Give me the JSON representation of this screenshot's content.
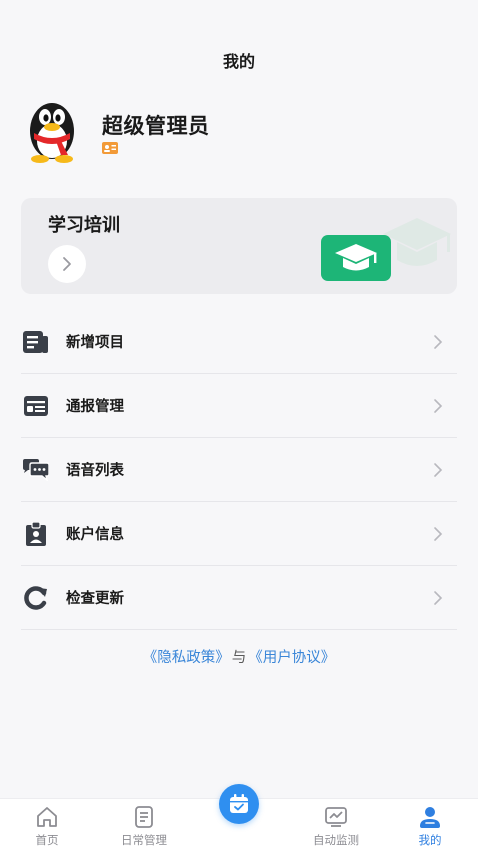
{
  "header": {
    "title": "我的"
  },
  "profile": {
    "username": "超级管理员"
  },
  "training_card": {
    "title": "学习培训"
  },
  "menu": {
    "items": [
      {
        "label": "新增项目",
        "icon": "document-icon"
      },
      {
        "label": "通报管理",
        "icon": "id-card-icon"
      },
      {
        "label": "语音列表",
        "icon": "chat-bubbles-icon"
      },
      {
        "label": "账户信息",
        "icon": "clipboard-user-icon"
      },
      {
        "label": "检查更新",
        "icon": "refresh-icon"
      }
    ]
  },
  "footer": {
    "privacy_link": "《隐私政策》",
    "separator": "与",
    "agreement_link": "《用户协议》"
  },
  "tabbar": {
    "tabs": [
      {
        "label": "首页",
        "icon": "home-icon"
      },
      {
        "label": "日常管理",
        "icon": "list-icon"
      },
      {
        "label": "",
        "icon": "calendar-check-icon"
      },
      {
        "label": "自动监测",
        "icon": "monitor-icon"
      },
      {
        "label": "我的",
        "icon": "user-icon"
      }
    ],
    "active_index": 4
  },
  "colors": {
    "accent": "#2f7fe0",
    "link": "#3a86d8",
    "training_green": "#1db577",
    "icon_dark": "#3a3f48"
  }
}
